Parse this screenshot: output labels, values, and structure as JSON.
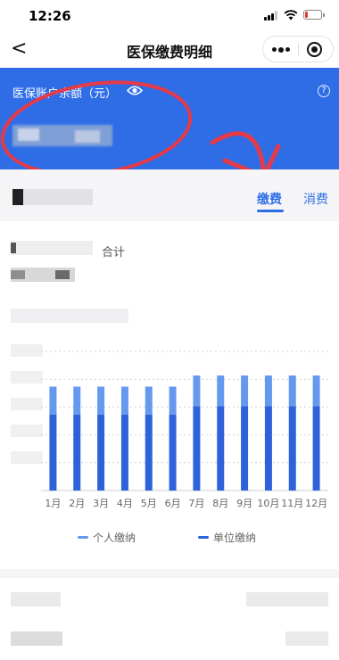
{
  "status_bar": {
    "time": "12:26"
  },
  "nav": {
    "back": "<",
    "title": "医保缴费明细"
  },
  "balance": {
    "label": "医保账户余额（元）",
    "help": "?"
  },
  "tabs": {
    "pay": "缴费",
    "consume": "消费",
    "active": "缴费"
  },
  "summary": {
    "total_label": "合计"
  },
  "colors": {
    "accent": "#2f6de7",
    "personal": "#6598ef",
    "unit": "#2d62da"
  },
  "icons": [
    "back-icon",
    "more-icon",
    "target-icon",
    "eye-icon",
    "help-icon"
  ],
  "chart_data": {
    "type": "bar",
    "stacked": true,
    "categories": [
      "1月",
      "2月",
      "3月",
      "4月",
      "5月",
      "6月",
      "7月",
      "8月",
      "9月",
      "10月",
      "11月",
      "12月"
    ],
    "series": [
      {
        "name": "单位缴纳",
        "values": [
          82,
          82,
          82,
          82,
          82,
          82,
          91,
          91,
          91,
          91,
          91,
          91
        ]
      },
      {
        "name": "个人缴纳",
        "values": [
          30,
          30,
          30,
          30,
          30,
          30,
          33,
          33,
          33,
          33,
          33,
          33
        ]
      }
    ],
    "ylim": [
      0,
      150
    ],
    "grid": true,
    "legend": "bottom"
  }
}
